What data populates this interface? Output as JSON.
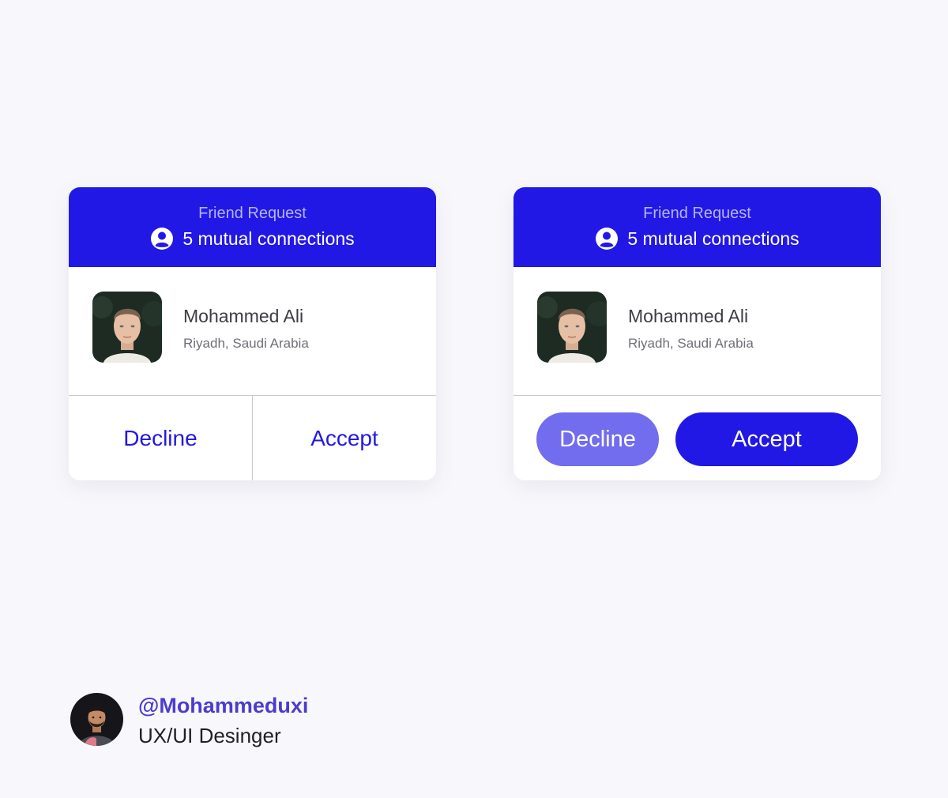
{
  "cards": [
    {
      "header": {
        "label": "Friend Request",
        "mutual_text": "5 mutual connections",
        "icon": "user-circle-icon"
      },
      "profile": {
        "name": "Mohammed Ali",
        "location": "Riyadh, Saudi Arabia"
      },
      "actions": {
        "style": "split",
        "decline_label": "Decline",
        "accept_label": "Accept"
      }
    },
    {
      "header": {
        "label": "Friend Request",
        "mutual_text": "5 mutual connections",
        "icon": "user-circle-icon"
      },
      "profile": {
        "name": "Mohammed Ali",
        "location": "Riyadh, Saudi Arabia"
      },
      "actions": {
        "style": "pill",
        "decline_label": "Decline",
        "accept_label": "Accept"
      }
    }
  ],
  "author": {
    "handle": "@Mohammeduxi",
    "role": "UX/UI Desinger"
  },
  "colors": {
    "background": "#f8f8fc",
    "primary": "#2118e6",
    "secondary": "#726cee",
    "header_label": "#b6b3f7",
    "author_handle": "#4b3ccd"
  }
}
